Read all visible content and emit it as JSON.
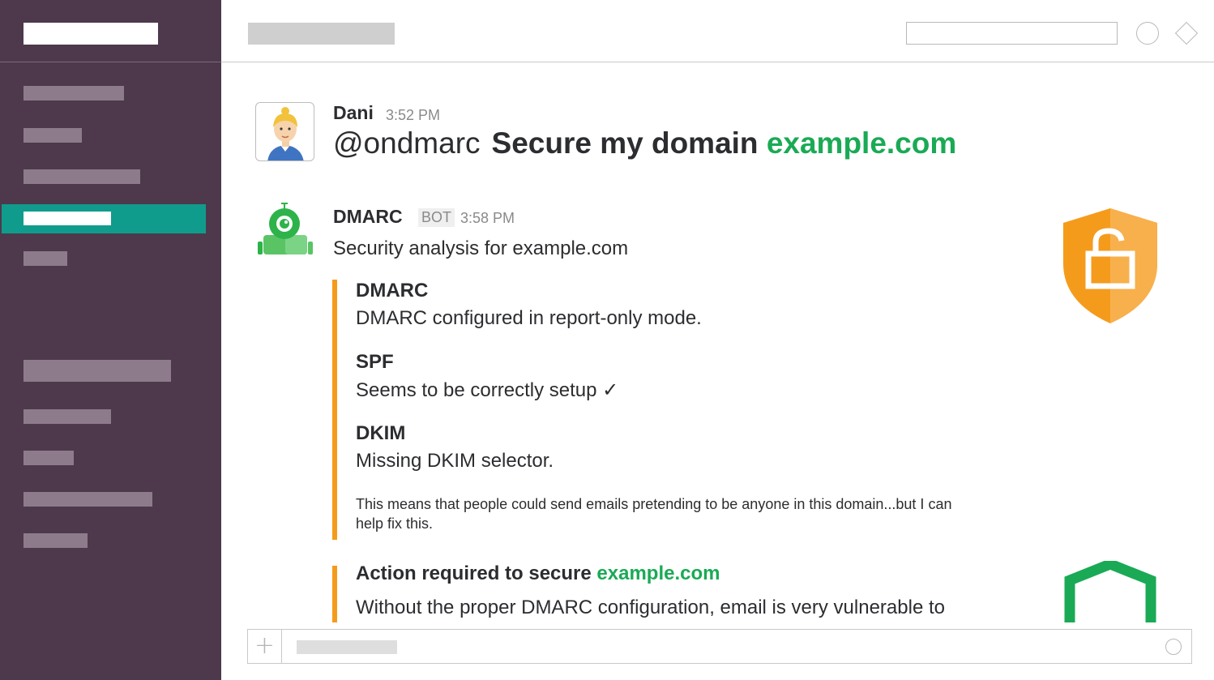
{
  "message_user": {
    "name": "Dani",
    "time": "3:52 PM",
    "mention": "@ondmarc",
    "command": "Secure my domain",
    "domain": "example.com"
  },
  "message_bot": {
    "name": "DMARC",
    "badge": "BOT",
    "time": "3:58 PM",
    "intro": "Security analysis for example.com",
    "checks": [
      {
        "title": "DMARC",
        "text": "DMARC configured in report-only mode."
      },
      {
        "title": "SPF",
        "text": "Seems to be correctly setup ✓"
      },
      {
        "title": "DKIM",
        "text": "Missing DKIM selector."
      }
    ],
    "note": "This means that people could send emails pretending to be anyone in this domain...but I can help fix this.",
    "action": {
      "title_prefix": "Action required to secure ",
      "title_domain": "example.com",
      "text": "Without the proper DMARC configuration, email is very vulnerable to"
    }
  },
  "colors": {
    "sidebar": "#4d394b",
    "active": "#109c8c",
    "accent_orange": "#f59b1c",
    "accent_green": "#1aaa55"
  },
  "icons": {
    "composer_add": "plus-icon",
    "status": "circle-icon",
    "header_action": "diamond-icon",
    "warning_shield": "unlocked-shield-icon",
    "secure_shield": "shield-icon"
  },
  "composer": {
    "plus": "+"
  }
}
